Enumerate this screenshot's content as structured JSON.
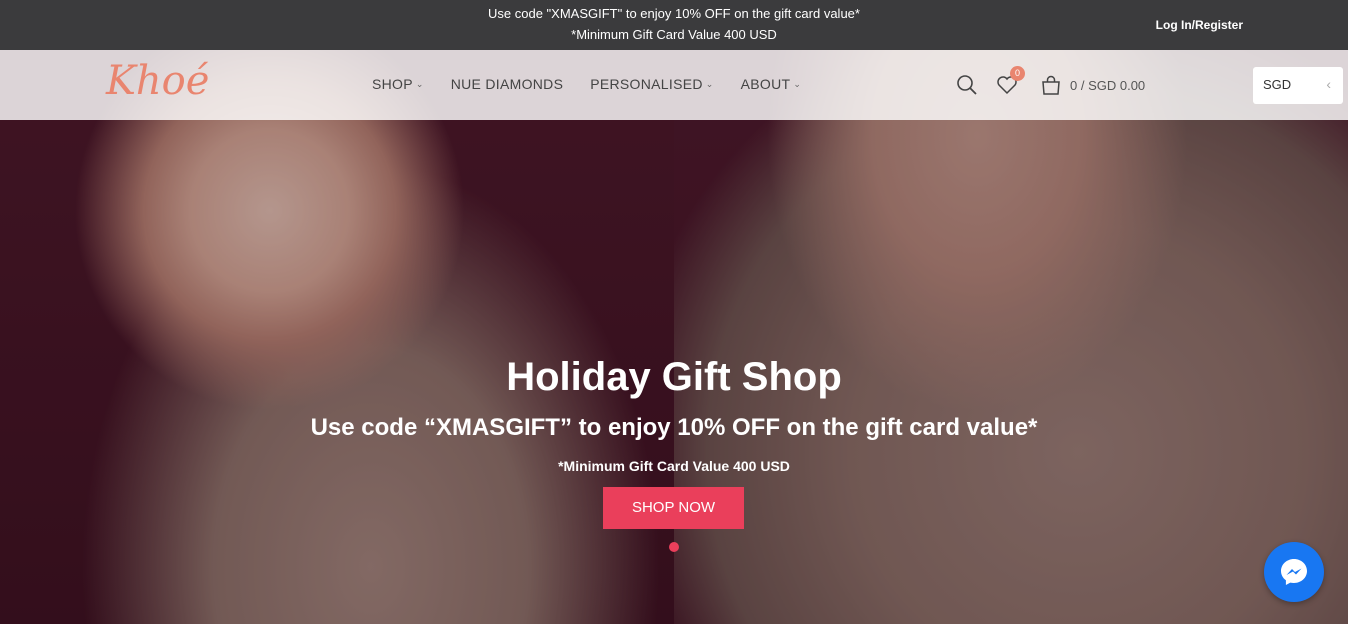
{
  "topbar": {
    "promo_line1": "Use code \"XMASGIFT\" to enjoy 10% OFF on the gift card value*",
    "promo_line2": "*Minimum Gift Card Value 400 USD",
    "login_label": "Log In/Register"
  },
  "header": {
    "logo_text": "Khoé",
    "nav": [
      {
        "label": "SHOP",
        "has_dropdown": true
      },
      {
        "label": "NUE DIAMONDS",
        "has_dropdown": false
      },
      {
        "label": "PERSONALISED",
        "has_dropdown": true
      },
      {
        "label": "ABOUT",
        "has_dropdown": true
      }
    ],
    "wishlist_count": "0",
    "cart_total": "0 / SGD 0.00",
    "currency": "SGD"
  },
  "hero": {
    "title": "Holiday Gift Shop",
    "subtitle": "Use code “XMASGIFT” to enjoy 10% OFF on the gift card value*",
    "note": "*Minimum Gift Card Value 400 USD",
    "button_label": "SHOP NOW"
  },
  "colors": {
    "accent": "#ea3f5b",
    "logo": "#e9856f",
    "topbar_bg": "#3b3b3d",
    "messenger": "#1877f2"
  },
  "icons": [
    "search-icon",
    "heart-icon",
    "shopping-bag-icon",
    "chevron-left-icon",
    "messenger-icon",
    "chevron-down-icon"
  ]
}
